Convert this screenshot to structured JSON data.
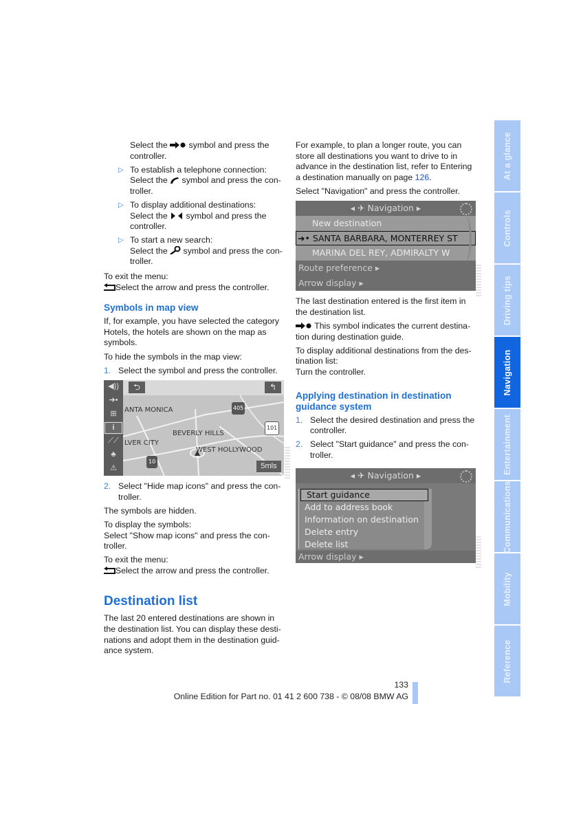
{
  "left_column": {
    "intro_line": [
      "Select the",
      "symbol and press the controller."
    ],
    "bullets": [
      {
        "lead": "To establish a telephone connection:",
        "pre": "Select the",
        "icon": "phone-icon",
        "post": "symbol and press the con-troller."
      },
      {
        "lead": "To display additional destinations:",
        "pre": "Select the",
        "icon": "arrows-left-right-icon",
        "post": "symbol and press the controller."
      },
      {
        "lead": "To start a new search:",
        "pre": "Select the",
        "icon": "search-key-icon",
        "post": "symbol and press the con-troller."
      }
    ],
    "exit_label_1": "To exit the menu:",
    "exit_text_1": "Select the arrow and press the controller.",
    "section_symbols_title": "Symbols in map view",
    "symbols_para": "If, for example, you have selected the category Hotels, the hotels are shown on the map as symbols.",
    "hide_label": "To hide the symbols in the map view:",
    "steps": [
      {
        "n": "1.",
        "text": "Select the symbol and press the controller."
      },
      {
        "n": "2.",
        "text": "Select \"Hide map icons\" and press the con-troller."
      }
    ],
    "hidden_text": "The symbols are hidden.",
    "display_label": "To display the symbols:",
    "display_text": "Select \"Show map icons\" and press the con-troller.",
    "exit_label_2": "To exit the menu:",
    "exit_text_2": "Select the arrow and press the controller.",
    "dest_list_title": "Destination list",
    "dest_list_para": "The last 20 entered destinations are shown in the destination list. You can display these desti-nations and adopt them in the destination guid-ance system."
  },
  "map_screen": {
    "side_icons": [
      "volume-icon",
      "destination-icon",
      "map-grid-icon",
      "info-icon",
      "road-icon",
      "traffic-icon",
      "warning-icon"
    ],
    "labels": [
      "ANTA MONICA",
      "BEVERLY HILLS",
      "LVER CITY",
      "WEST HOLLYWOOD"
    ],
    "shields": [
      "405",
      "101",
      "10"
    ],
    "scale": "5mls"
  },
  "right_column": {
    "intro_para_pre": "For example, to plan a longer route, you can store all destinations you want to drive to in advance in the destination list, refer to Entering a destination manually on page ",
    "intro_page_link": "126",
    "intro_para_post": ".",
    "select_nav": "Select \"Navigation\" and press the controller.",
    "last_dest": "The last destination entered is the first item in the destination list.",
    "symbol_text": "This symbol indicates the current destina-tion during destination guide.",
    "additional_label": "To display additional destinations from the des-tination list:",
    "turn_text": "Turn the controller.",
    "applying_title": "Applying destination in destination guidance system",
    "steps": [
      {
        "n": "1.",
        "text": "Select the desired destination and press the controller."
      },
      {
        "n": "2.",
        "text": "Select \"Start guidance\" and press the con-troller."
      }
    ]
  },
  "nav_screen": {
    "header": "Navigation",
    "rows": [
      "New destination",
      "SANTA BARBARA, MONTERREY ST",
      "MARINA DEL REY, ADMIRALTY W"
    ],
    "footer_rows": [
      "Route preference",
      "Arrow display"
    ]
  },
  "menu_screen": {
    "header": "Navigation",
    "items": [
      "Start guidance",
      "Add to address book",
      "Information on destination",
      "Delete entry",
      "Delete list"
    ],
    "footer_row": "Arrow display"
  },
  "tabs": [
    {
      "label": "At a glance",
      "active": false
    },
    {
      "label": "Controls",
      "active": false
    },
    {
      "label": "Driving tips",
      "active": false
    },
    {
      "label": "Navigation",
      "active": true
    },
    {
      "label": "Entertainment",
      "active": false
    },
    {
      "label": "Communications",
      "active": false
    },
    {
      "label": "Mobility",
      "active": false
    },
    {
      "label": "Reference",
      "active": false
    }
  ],
  "footer": {
    "page_number": "133",
    "edition": "Online Edition for Part no. 01 41 2 600 738 - © 08/08 BMW AG"
  }
}
